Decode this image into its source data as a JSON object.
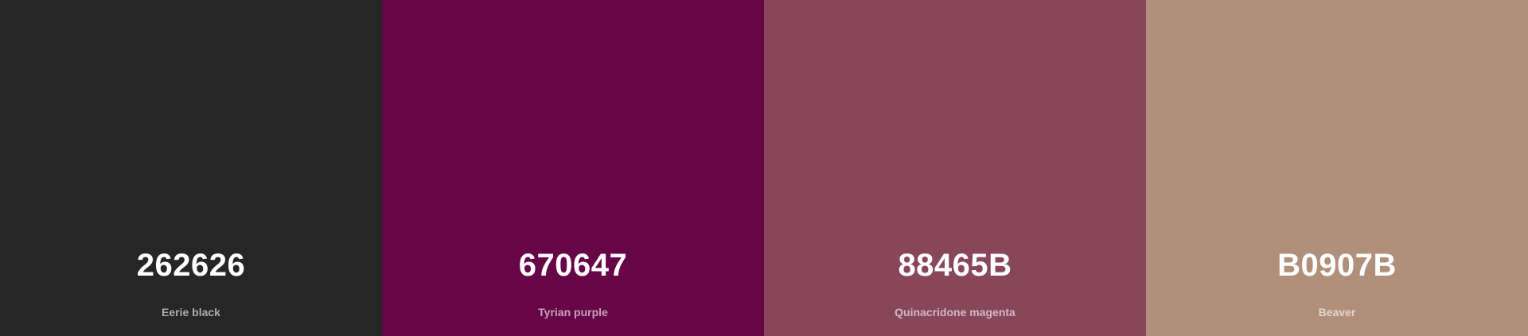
{
  "palette": {
    "colors": [
      {
        "hex": "262626",
        "name": "Eerie black",
        "color": "#262626"
      },
      {
        "hex": "670647",
        "name": "Tyrian purple",
        "color": "#670647"
      },
      {
        "hex": "88465B",
        "name": "Quinacridone magenta",
        "color": "#88465B"
      },
      {
        "hex": "B0907B",
        "name": "Beaver",
        "color": "#B0907B"
      }
    ]
  }
}
